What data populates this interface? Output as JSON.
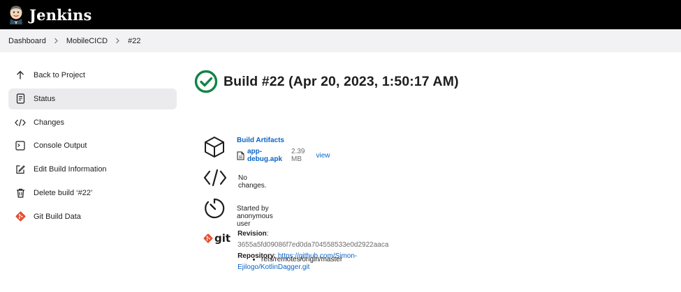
{
  "header": {
    "brand": "Jenkins",
    "logo_icon": "jenkins-butler-logo"
  },
  "breadcrumb": [
    "Dashboard",
    "MobileCICD",
    "#22"
  ],
  "sidebar": {
    "items": [
      {
        "label": "Back to Project",
        "icon": "arrow-up-icon"
      },
      {
        "label": "Status",
        "icon": "document-icon",
        "active": true
      },
      {
        "label": "Changes",
        "icon": "code-icon"
      },
      {
        "label": "Console Output",
        "icon": "terminal-icon"
      },
      {
        "label": "Edit Build Information",
        "icon": "edit-icon"
      },
      {
        "label": "Delete build ‘#22’",
        "icon": "trash-icon"
      },
      {
        "label": "Git Build Data",
        "icon": "git-icon"
      }
    ]
  },
  "build": {
    "status_icon": "success-check-icon",
    "status_color": "#138347",
    "title": "Build #22 (Apr 20, 2023, 1:50:17 AM)"
  },
  "artifacts": {
    "heading": "Build Artifacts",
    "file_name": "app-debug.apk",
    "file_size": "2.39 MB",
    "view_label": "view"
  },
  "changes": {
    "text": "No changes."
  },
  "cause": {
    "text": "Started by anonymous user"
  },
  "git": {
    "logo_text": "git",
    "revision_label": "Revision",
    "revision_value": "3655a5fd09086f7ed0da704558533e0d2922aaca",
    "repository_label": "Repository",
    "repository_url": "https://github.com/Simon-Ejilogo/KotlinDagger.git",
    "branches": [
      "refs/remotes/origin/master"
    ]
  },
  "colors": {
    "link": "#0b64c4",
    "header_bg": "#000000",
    "breadcrumb_bg": "#f2f2f4",
    "git_red": "#e84e31"
  }
}
